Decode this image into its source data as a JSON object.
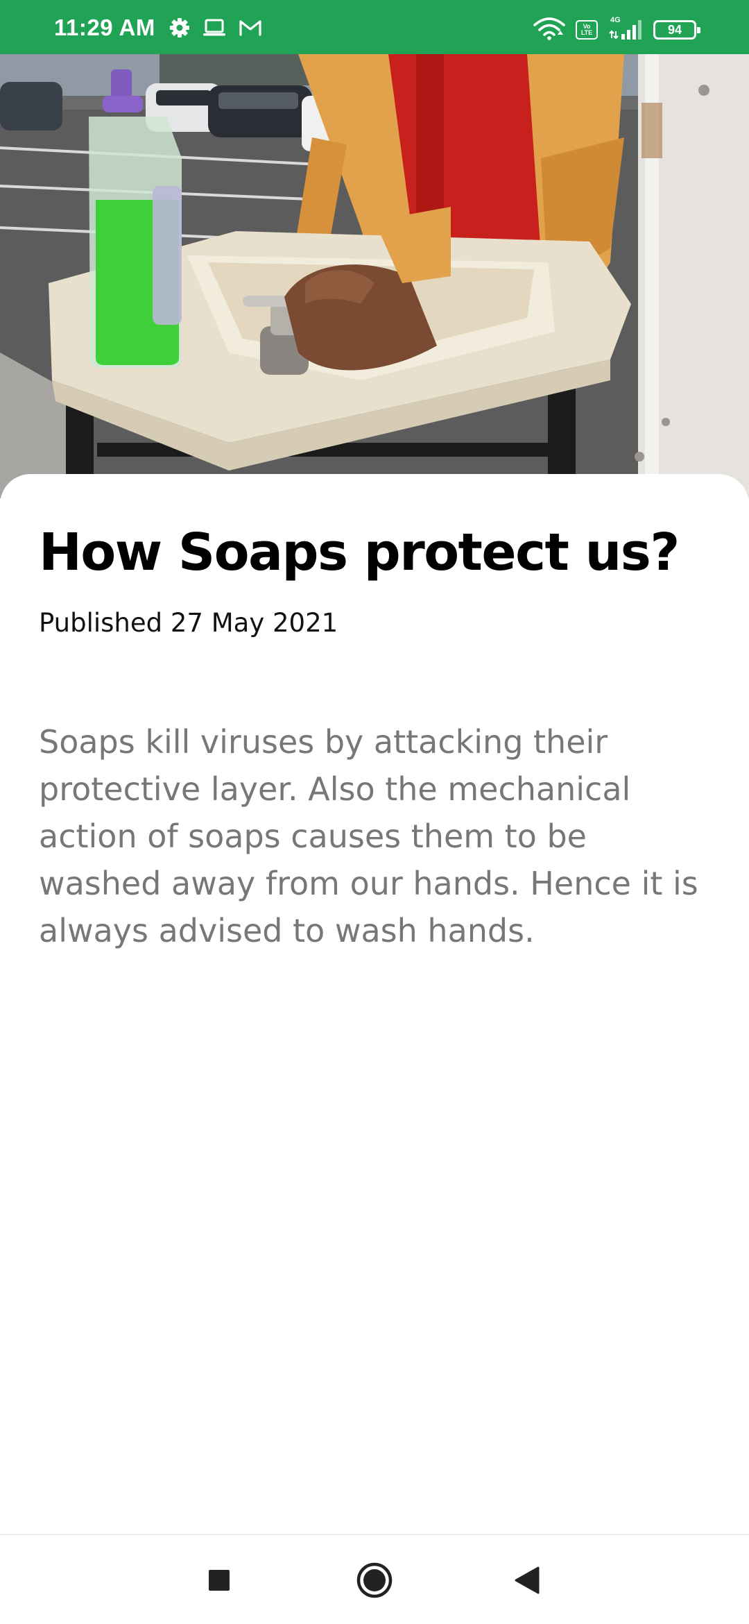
{
  "status_bar": {
    "time": "11:29 AM",
    "left_icons": [
      "gear-icon",
      "laptop-icon",
      "gmail-icon"
    ],
    "right_icons": [
      "wifi-icon",
      "volte-icon",
      "signal-icon",
      "battery-icon"
    ],
    "volte_top": "Vo",
    "volte_bottom": "LTE",
    "network_type": "4G",
    "battery_level": "94",
    "background_color": "#21a355"
  },
  "hero": {
    "image_name": "hero-image"
  },
  "article": {
    "title": "How Soaps protect us?",
    "published": "Published 27 May 2021",
    "body": "Soaps kill viruses by attacking their protective layer. Also the mechanical action of soaps causes them to be washed away from our hands. Hence it is always advised to wash hands.",
    "title_color": "#000000",
    "body_color": "#777777"
  },
  "nav_bar": {
    "buttons": [
      "recents-button",
      "home-button",
      "back-button"
    ],
    "icon_color": "#222222"
  }
}
